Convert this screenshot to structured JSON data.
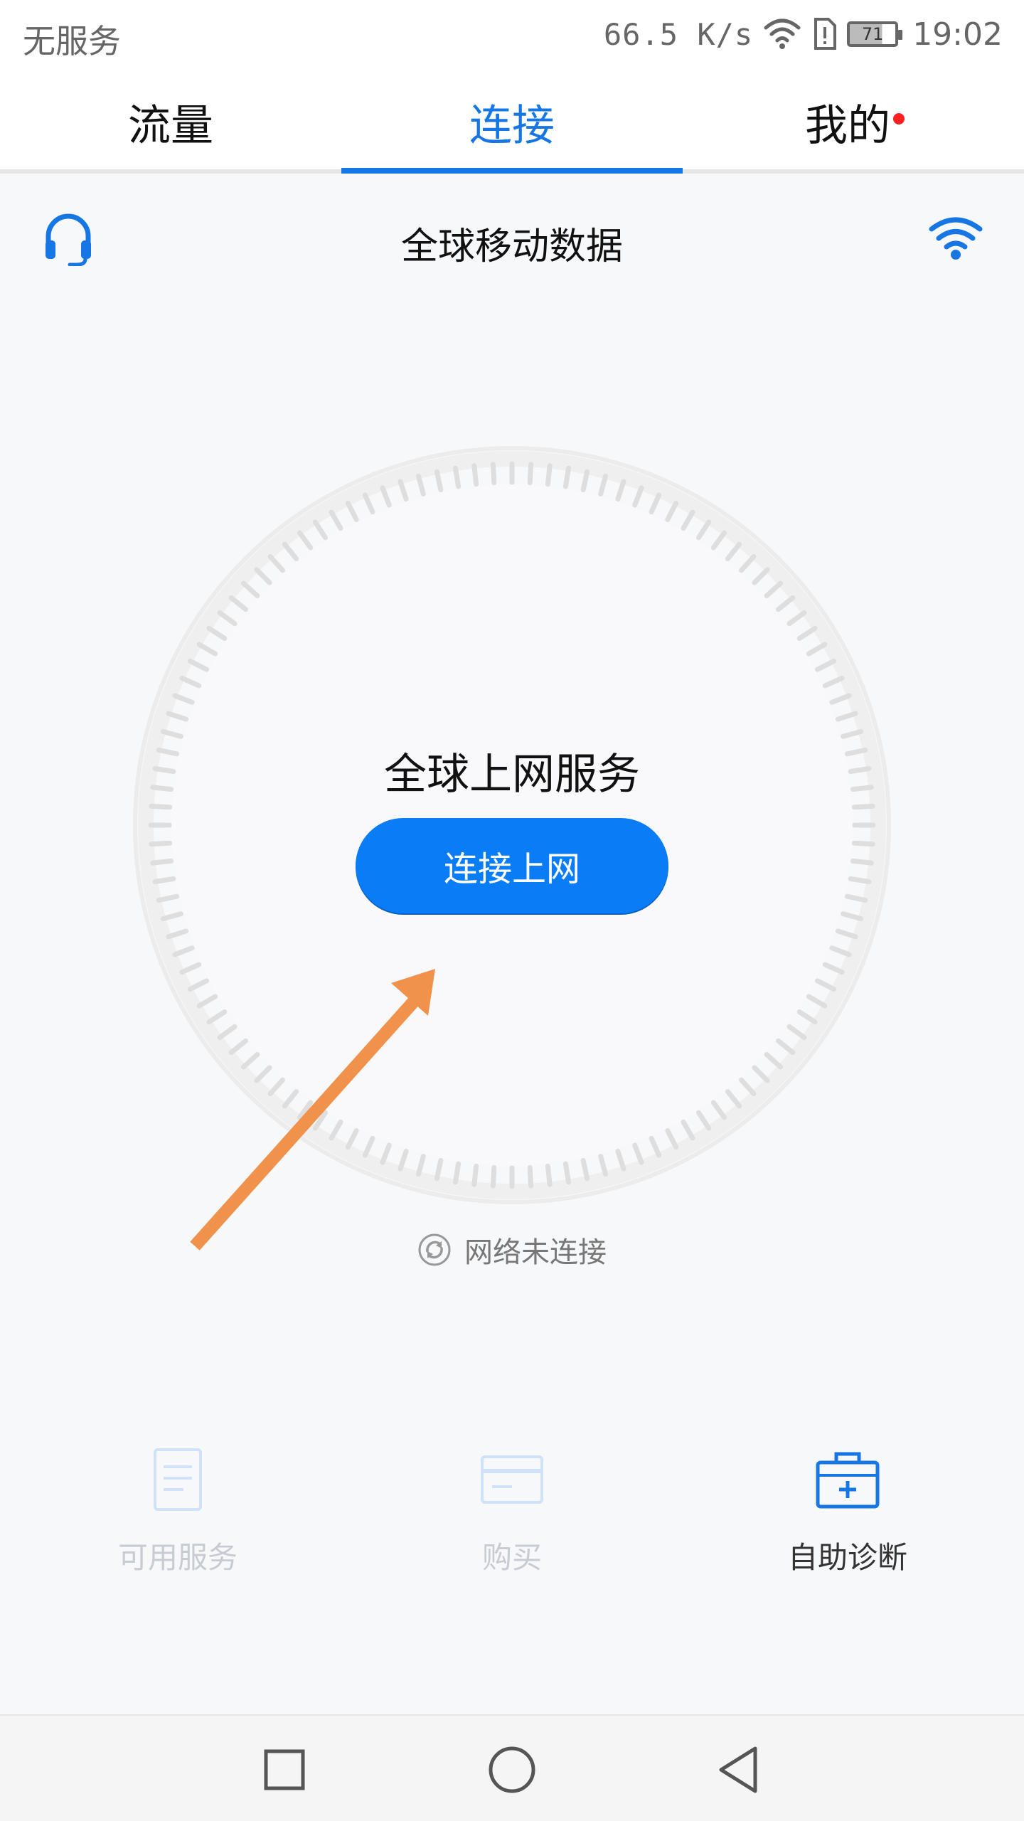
{
  "status_bar": {
    "carrier": "无服务",
    "speed": "66.5 K/s",
    "battery": "71",
    "time": "19:02",
    "battery_level": 0.71
  },
  "tabs": [
    {
      "label": "流量",
      "active": false
    },
    {
      "label": "连接",
      "active": true
    },
    {
      "label": "我的",
      "active": false,
      "badge_dot": true
    }
  ],
  "header": {
    "title": "全球移动数据",
    "left_icon": "headset-icon",
    "right_icon": "wifi-icon"
  },
  "main": {
    "service_title": "全球上网服务",
    "connect_button": "连接上网",
    "network_status": "网络未连接",
    "network_status_icon": "sync-icon"
  },
  "actions": [
    {
      "label": "可用服务",
      "icon": "document-icon",
      "enabled": false
    },
    {
      "label": "购买",
      "icon": "card-icon",
      "enabled": false
    },
    {
      "label": "自助诊断",
      "icon": "first-aid-kit-icon",
      "enabled": true
    }
  ],
  "nav": {
    "buttons": [
      "recents-square-icon",
      "home-circle-icon",
      "back-triangle-icon"
    ]
  },
  "colors": {
    "accent": "#1677e4",
    "button": "#0a7cf5",
    "arrow": "#f0924c",
    "badge": "#ff2020",
    "disabled": "#c7ccd2"
  }
}
